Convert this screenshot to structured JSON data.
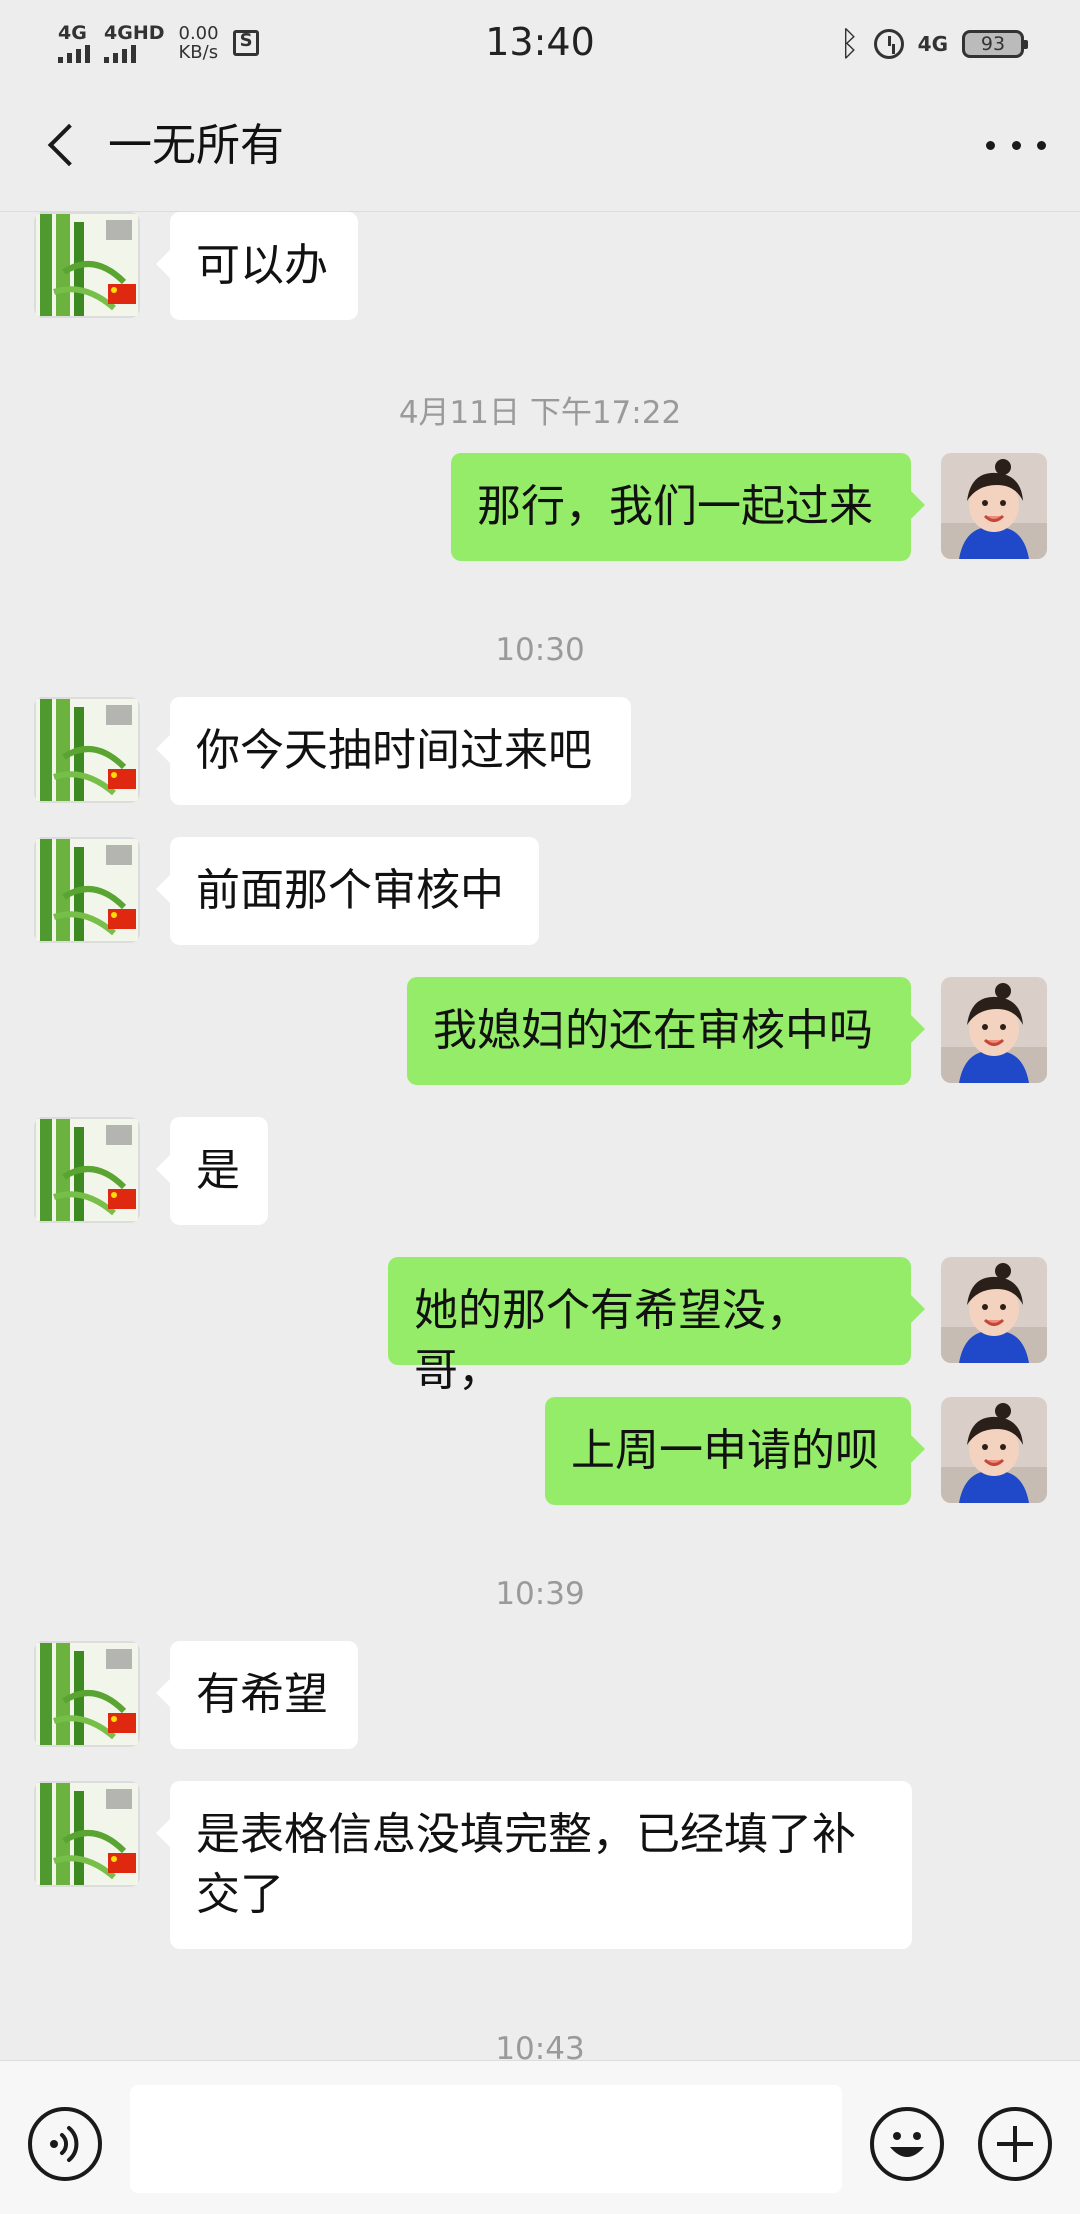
{
  "status_bar": {
    "signal1_label": "4G",
    "signal2_label": "4GHD",
    "net_speed_value": "0.00",
    "net_speed_unit": "KB/s",
    "time": "13:40",
    "lte_label": "4G",
    "battery": "93"
  },
  "header": {
    "title": "一无所有"
  },
  "colors": {
    "background": "#ededed",
    "outgoing_bubble": "#95ec69",
    "incoming_bubble": "#ffffff",
    "timestamp_text": "#9a9a9a"
  },
  "messages": [
    {
      "kind": "in",
      "text": "可以办"
    },
    {
      "kind": "time",
      "text": "4月11日 下午17:22"
    },
    {
      "kind": "out",
      "text": "那行，我们一起过来"
    },
    {
      "kind": "time",
      "text": "10:30"
    },
    {
      "kind": "in",
      "text": "你今天抽时间过来吧"
    },
    {
      "kind": "in",
      "text": "前面那个审核中"
    },
    {
      "kind": "out",
      "text": "我媳妇的还在审核中吗"
    },
    {
      "kind": "in",
      "text": "是"
    },
    {
      "kind": "out",
      "text": "她的那个有希望没，哥，"
    },
    {
      "kind": "out",
      "text": "上周一申请的呗"
    },
    {
      "kind": "time",
      "text": "10:39"
    },
    {
      "kind": "in",
      "text": "有希望"
    },
    {
      "kind": "in",
      "text": "是表格信息没填完整，已经填了补\n交了"
    },
    {
      "kind": "time",
      "text": "10:43"
    }
  ],
  "input": {
    "value": "",
    "placeholder": ""
  }
}
